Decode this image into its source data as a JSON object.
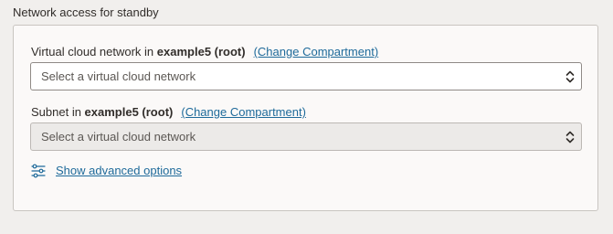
{
  "section": {
    "title": "Network access for standby"
  },
  "vcn": {
    "label_prefix": "Virtual cloud network in ",
    "compartment": "example5 (root)",
    "change_link": "(Change Compartment)",
    "placeholder": "Select a virtual cloud network",
    "disabled": false
  },
  "subnet": {
    "label_prefix": "Subnet in ",
    "compartment": "example5 (root)",
    "change_link": "(Change Compartment)",
    "placeholder": "Select a virtual cloud network",
    "disabled": true
  },
  "advanced": {
    "label": "Show advanced options",
    "icon": "sliders-icon"
  },
  "colors": {
    "link": "#1e6a9a",
    "text": "#312d2a",
    "panel_bg": "#fbf9f8",
    "page_bg": "#f1efed",
    "disabled_bg": "#eceae8"
  }
}
